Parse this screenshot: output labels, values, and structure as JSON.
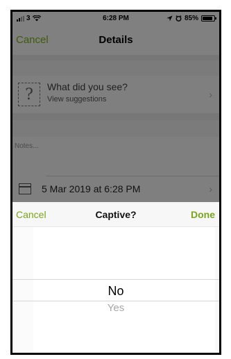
{
  "status_bar": {
    "carrier": "3",
    "time": "6:28 PM",
    "battery_text": "85%",
    "battery_level": 0.85
  },
  "details": {
    "nav": {
      "cancel_label": "Cancel",
      "title": "Details"
    },
    "observation": {
      "title": "What did you see?",
      "subtitle": "View suggestions",
      "icon_glyph": "?"
    },
    "notes_placeholder": "Notes...",
    "date": "5 Mar 2019 at 6:28 PM",
    "chevron": "›"
  },
  "picker": {
    "cancel_label": "Cancel",
    "title": "Captive?",
    "done_label": "Done",
    "options": [
      "No",
      "Yes"
    ],
    "selected": "No"
  },
  "icons": {
    "signal": "signal-bars-icon",
    "wifi": "wifi-icon",
    "location": "location-arrow-icon",
    "alarm": "alarm-icon",
    "battery": "battery-icon",
    "observation": "question-box-icon",
    "calendar": "calendar-icon"
  },
  "colors": {
    "accent_green": "#78a51a",
    "dim_overlay": "#808080"
  }
}
